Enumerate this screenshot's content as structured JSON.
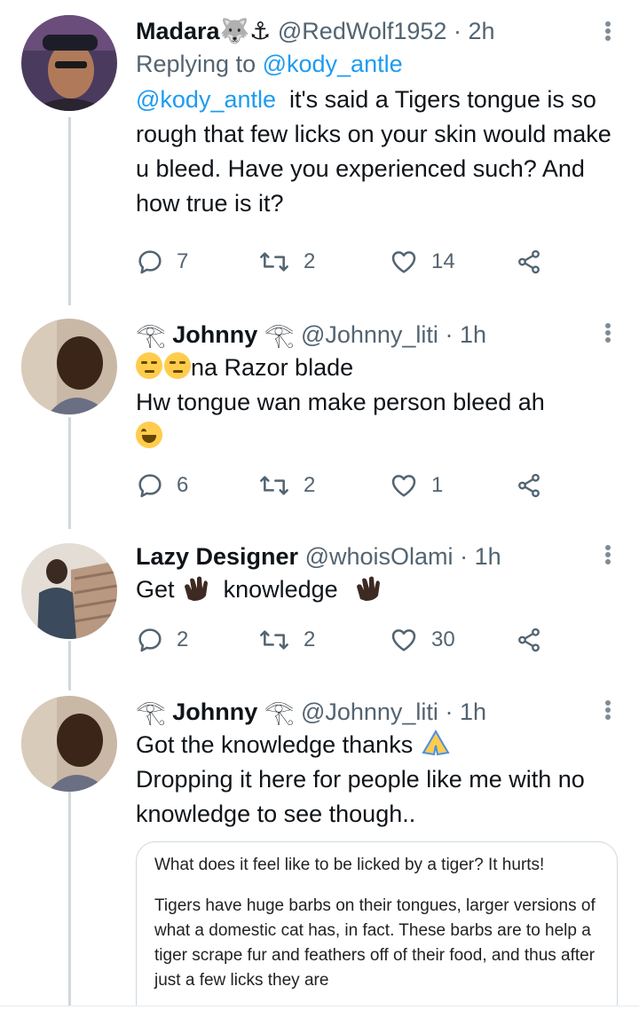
{
  "tweets": [
    {
      "display_name": "Madara",
      "name_glyph": "🐺⚓",
      "handle": "@RedWolf1952",
      "dot": "·",
      "time": "2h",
      "replying_label": "Replying to ",
      "replying_handle": "@kody_antle",
      "mention": "@kody_antle",
      "text": "  it's said a Tigers tongue is so rough that few licks on your skin would make u bleed. Have you experienced such? And how true is it?",
      "replies": "7",
      "retweets": "2",
      "likes": "14"
    },
    {
      "name_prefix": "𓂀 ",
      "display_name": "Johnny",
      "name_suffix": " 𓂀",
      "handle": "@Johnny_liti",
      "dot": "·",
      "time": "1h",
      "line1": "na Razor blade",
      "line2": "Hw tongue wan make person bleed ah",
      "replies": "6",
      "retweets": "2",
      "likes": "1"
    },
    {
      "display_name": "Lazy Designer",
      "handle": "@whoisOlami",
      "dot": "·",
      "time": "1h",
      "word1": "Get",
      "word2": "knowledge",
      "replies": "2",
      "retweets": "2",
      "likes": "30"
    },
    {
      "name_prefix": "𓂀 ",
      "display_name": "Johnny",
      "name_suffix": " 𓂀",
      "handle": "@Johnny_liti",
      "dot": "·",
      "time": "1h",
      "line1": "Got the knowledge thanks",
      "line2": "Dropping it here for people like me with no knowledge to see though..",
      "quote_title": "What does it feel like to be licked by a tiger? It hurts!",
      "quote_body": "Tigers have huge barbs on their tongues, larger versions of what a domestic cat has, in fact. These barbs are to help a tiger scrape fur and feathers off of their food, and thus after just a few licks they are"
    }
  ],
  "colors": {
    "accent": "#1d9bf0",
    "secondary_text": "#536471",
    "thread_line": "#cfd9de",
    "icon": "#536471"
  },
  "icons": [
    "reply-icon",
    "retweet-icon",
    "like-icon",
    "share-icon",
    "more-icon"
  ]
}
